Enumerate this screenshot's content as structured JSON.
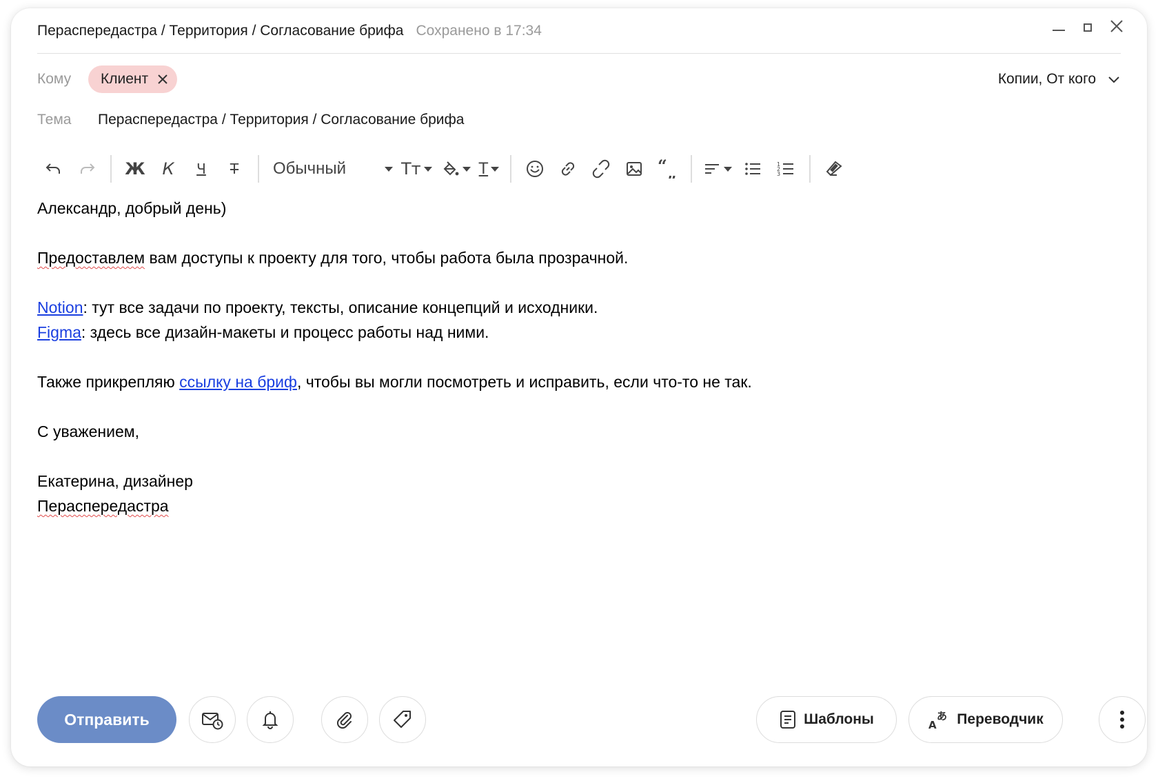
{
  "window": {
    "title": "Пераспередастра / Территория / Согласование брифа",
    "saved_status": "Сохранено в 17:34"
  },
  "recipients": {
    "to_label": "Кому",
    "chips": [
      {
        "label": "Клиент"
      }
    ],
    "copies_label": "Копии, От кого"
  },
  "subject": {
    "label": "Тема",
    "value": "Пераспередастра / Территория / Согласование брифа"
  },
  "toolbar": {
    "bold": "Ж",
    "italic": "К",
    "underline": "Ч",
    "strike": "Т",
    "text_style": "Обычный",
    "font_size": "Тт",
    "text_color": "Т"
  },
  "body": {
    "greeting": "Александр, добрый день)",
    "line1_misspelled": "Предоставлем",
    "line1_rest": " вам доступы к проекту для того, чтобы работа была прозрачной.",
    "notion_link": "Notion",
    "notion_rest": ": тут все задачи по проекту, тексты, описание концепций и исходники.",
    "figma_link": "Figma",
    "figma_rest": ": здесь все дизайн-макеты и процесс работы над ними.",
    "brief_prefix": "Также прикрепляю ",
    "brief_link": "ссылку на бриф",
    "brief_rest": ", чтобы вы могли посмотреть и исправить, если что-то не так.",
    "regards": "С уважением,",
    "signature_name": "Екатерина, дизайнер",
    "signature_company": "Пераспередастра"
  },
  "bottom": {
    "send_label": "Отправить",
    "templates_label": "Шаблоны",
    "translator_label": "Переводчик"
  },
  "colors": {
    "send_button": "#6b8cc7",
    "chip_background": "#f8d2d2",
    "link": "#1a3fe0"
  }
}
